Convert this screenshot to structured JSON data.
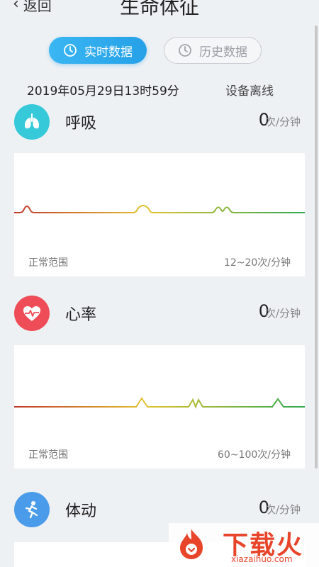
{
  "header": {
    "back_label": "返回",
    "title": "生命体征"
  },
  "tabs": [
    {
      "label": "实时数据",
      "active": true
    },
    {
      "label": "历史数据",
      "active": false
    }
  ],
  "datetime": "2019年05月29日13时59分",
  "device_status": "设备离线",
  "metrics": [
    {
      "name": "呼吸",
      "value": "0",
      "unit": "次/分钟",
      "icon": "lungs-icon",
      "color": "#35c9d9",
      "range_label": "正常范围",
      "range_value": "12~20次/分钟"
    },
    {
      "name": "心率",
      "value": "0",
      "unit": "次/分钟",
      "icon": "heartbeat-icon",
      "color": "#ee4d57",
      "range_label": "正常范围",
      "range_value": "60~100次/分钟"
    },
    {
      "name": "体动",
      "value": "0",
      "unit": "次/分钟",
      "icon": "running-person-icon",
      "color": "#4a9be9"
    }
  ],
  "watermark": {
    "brand": "下载火",
    "domain": "xiazaihuo.com"
  }
}
